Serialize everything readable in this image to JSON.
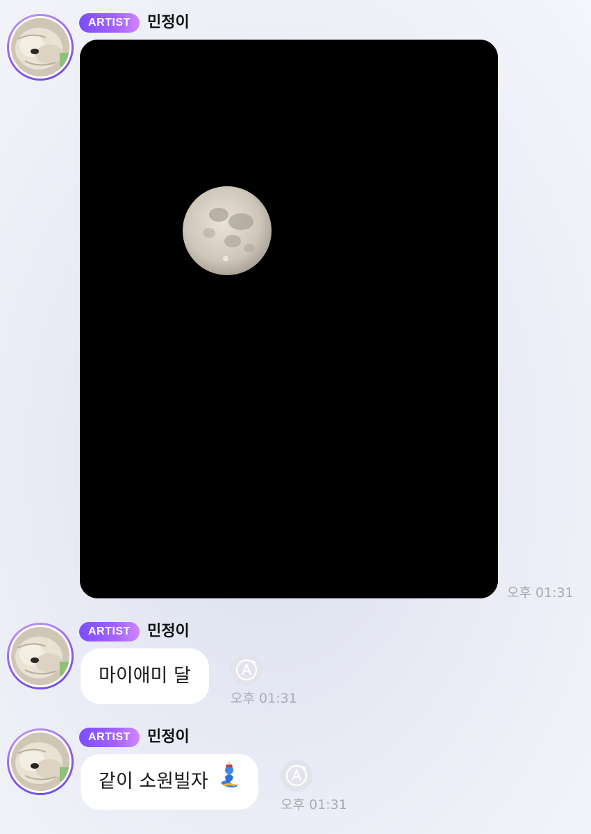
{
  "messages": [
    {
      "badge": "ARTIST",
      "sender": "민정이",
      "type": "photo",
      "photo_alt": "full moon in night sky",
      "time": "오후 01:31"
    },
    {
      "badge": "ARTIST",
      "sender": "민정이",
      "type": "text",
      "text": "마이애미 달",
      "time": "오후 01:31"
    },
    {
      "badge": "ARTIST",
      "sender": "민정이",
      "type": "text",
      "text": "같이 소원빌자",
      "emoji": "genie-emoji",
      "time": "오후 01:31"
    }
  ],
  "colors": {
    "badge_gradient_start": "#7c4dff",
    "badge_gradient_end": "#cf86ff",
    "avatar_ring": "#8f5bea",
    "bubble": "#ffffff",
    "timestamp": "#a9abb4"
  }
}
